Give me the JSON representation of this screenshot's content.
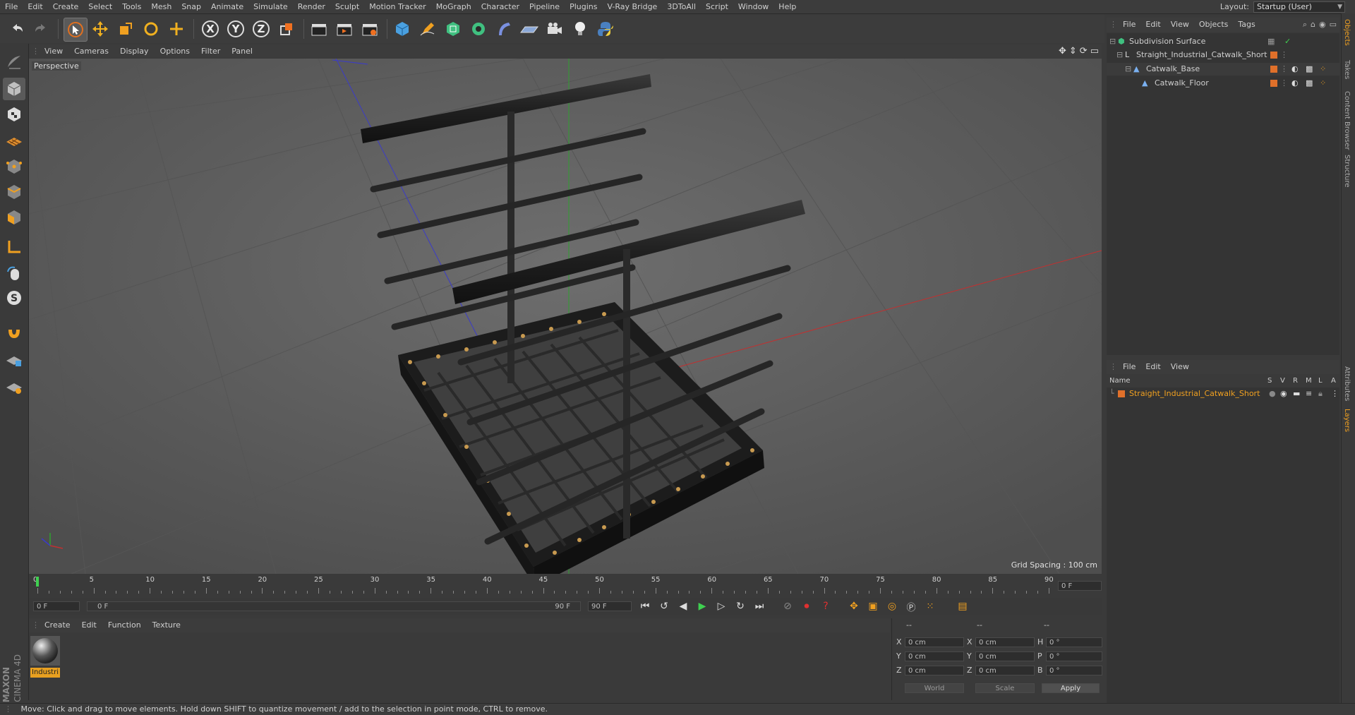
{
  "menubar": {
    "items": [
      "File",
      "Edit",
      "Create",
      "Select",
      "Tools",
      "Mesh",
      "Snap",
      "Animate",
      "Simulate",
      "Render",
      "Sculpt",
      "Motion Tracker",
      "MoGraph",
      "Character",
      "Pipeline",
      "Plugins",
      "V-Ray Bridge",
      "3DToAll",
      "Script",
      "Window",
      "Help"
    ],
    "layout_label": "Layout:",
    "layout_value": "Startup (User)"
  },
  "toolbar": {
    "x_label": "X",
    "y_label": "Y",
    "z_label": "Z"
  },
  "viewport": {
    "menu": [
      "View",
      "Cameras",
      "Display",
      "Options",
      "Filter",
      "Panel"
    ],
    "label": "Perspective",
    "grid_spacing": "Grid Spacing : 100 cm",
    "axis_x_color": "#c23030",
    "axis_y_color": "#2ea02e",
    "axis_z_color": "#3b3bc8"
  },
  "timeline": {
    "ticks": [
      "0",
      "5",
      "10",
      "15",
      "20",
      "25",
      "30",
      "35",
      "40",
      "45",
      "50",
      "55",
      "60",
      "65",
      "70",
      "75",
      "80",
      "85",
      "90"
    ],
    "current_frame_field": "0 F"
  },
  "transport": {
    "start_field": "0 F",
    "range_start": "0 F",
    "range_end": "90 F",
    "end_field": "90 F"
  },
  "material_manager": {
    "menu": [
      "Create",
      "Edit",
      "Function",
      "Texture"
    ],
    "material_name": "Industri",
    "brand": "MAXON",
    "product": "CINEMA 4D"
  },
  "coords": {
    "header_dashes": [
      "--",
      "--",
      "--"
    ],
    "rows": [
      {
        "l1": "X",
        "v1": "0 cm",
        "l2": "X",
        "v2": "0 cm",
        "l3": "H",
        "v3": "0 °"
      },
      {
        "l1": "Y",
        "v1": "0 cm",
        "l2": "Y",
        "v2": "0 cm",
        "l3": "P",
        "v3": "0 °"
      },
      {
        "l1": "Z",
        "v1": "0 cm",
        "l2": "Z",
        "v2": "0 cm",
        "l3": "B",
        "v3": "0 °"
      }
    ],
    "mode_world": "World",
    "mode_scale": "Scale",
    "apply": "Apply"
  },
  "object_manager": {
    "menu": [
      "File",
      "Edit",
      "View",
      "Objects",
      "Tags"
    ],
    "objects": [
      {
        "name": "Subdivision Surface",
        "indent": 0
      },
      {
        "name": "Straight_Industrial_Catwalk_Short",
        "indent": 1
      },
      {
        "name": "Catwalk_Base",
        "indent": 2
      },
      {
        "name": "Catwalk_Floor",
        "indent": 3
      }
    ]
  },
  "layer_manager": {
    "menu": [
      "File",
      "Edit",
      "View"
    ],
    "columns": [
      "Name",
      "S",
      "V",
      "R",
      "M",
      "L",
      "A"
    ],
    "layers": [
      {
        "name": "Straight_Industrial_Catwalk_Short",
        "color": "#e0702a"
      }
    ]
  },
  "side_tabs": [
    "Objects",
    "Takes",
    "Content Browser",
    "Structure",
    "Attributes",
    "Layers"
  ],
  "status": "Move: Click and drag to move elements. Hold down SHIFT to quantize movement / add to the selection in point mode, CTRL to remove."
}
